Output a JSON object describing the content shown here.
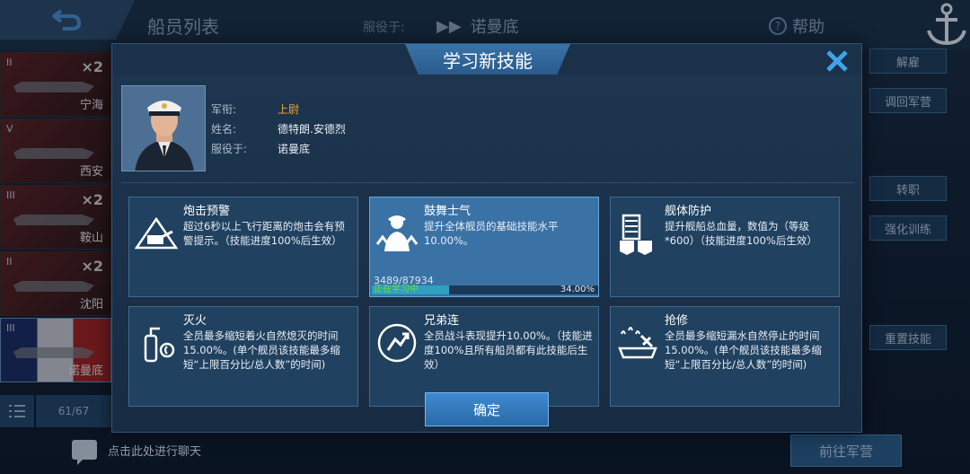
{
  "background": {
    "title": "船员列表",
    "service_label": "服役于:",
    "service_ship": "诺曼底",
    "help_label": "帮助",
    "ships": [
      {
        "tier": "II",
        "mult": "×2",
        "name": "宁海"
      },
      {
        "tier": "V",
        "mult": "",
        "name": "西安"
      },
      {
        "tier": "III",
        "mult": "×2",
        "name": "鞍山"
      },
      {
        "tier": "II",
        "mult": "×2",
        "name": "沈阳"
      },
      {
        "tier": "III",
        "mult": "",
        "name": "诺曼底"
      }
    ],
    "list_count": "61/67",
    "right_buttons": [
      "解雇",
      "调回军营",
      "转职",
      "强化训练",
      "重置技能"
    ],
    "chat_hint": "点击此处进行聊天",
    "goto_button": "前往军营"
  },
  "modal": {
    "title": "学习新技能",
    "officer": {
      "rank_label": "军衔:",
      "rank_value": "上尉",
      "name_label": "姓名:",
      "name_value": "德特朗.安德烈",
      "service_label": "服役于:",
      "service_value": "诺曼底"
    },
    "skills": [
      {
        "name": "炮击预警",
        "desc": "超过6秒以上飞行距离的炮击会有预警提示。（技能进度100%后生效）",
        "icon": "cannon-icon"
      },
      {
        "name": "鼓舞士气",
        "desc": "提升全体舰员的基础技能水平10.00%。",
        "icon": "officer-boost-icon",
        "progress_text": "3489/87934",
        "status": "正在学习中",
        "percent": "34.00%",
        "progress_fraction": 0.34
      },
      {
        "name": "舰体防护",
        "desc": "提升舰船总血量，数值为（等级*600）（技能进度100%后生效）",
        "icon": "ship-shield-icon"
      },
      {
        "name": "灭火",
        "desc": "全员最多缩短着火自然熄灭的时间15.00%。(单个舰员该技能最多缩短“上限百分比/总人数”的时间)",
        "icon": "extinguisher-icon"
      },
      {
        "name": "兄弟连",
        "desc": "全员战斗表现提升10.00%。（技能进度100%且所有船员都有此技能后生效）",
        "icon": "brotherhood-icon"
      },
      {
        "name": "抢修",
        "desc": "全员最多缩短漏水自然停止的时间15.00%。(单个舰员该技能最多缩短“上限百分比/总人数”的时间)",
        "icon": "repair-icon"
      }
    ],
    "confirm_label": "确定"
  }
}
